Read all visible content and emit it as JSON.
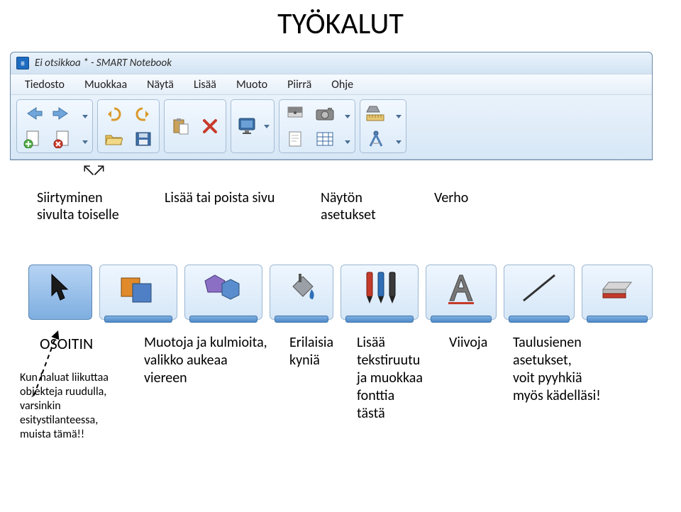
{
  "slide_title": "TYÖKALUT",
  "window": {
    "title": "Ei otsikkoa * - SMART Notebook",
    "app_icon_glyph": "≡"
  },
  "menubar": [
    "Tiedosto",
    "Muokkaa",
    "Näytä",
    "Lisää",
    "Muoto",
    "Piirrä",
    "Ohje"
  ],
  "toolbar1_names": {
    "back": "arrow-left-icon",
    "forward": "arrow-right-icon",
    "add_page": "add-page-icon",
    "undo": "undo-icon",
    "redo": "redo-icon",
    "delete_page": "delete-page-icon",
    "open": "open-folder-icon",
    "save": "save-icon",
    "paste": "paste-icon",
    "delete": "delete-x-icon",
    "display": "display-settings-icon",
    "screenshade": "screen-shade-icon",
    "camera": "camera-icon",
    "table": "table-icon",
    "ruler": "ruler-shapes-icon",
    "compass": "compass-icon"
  },
  "annotations1": {
    "move": "Siirtyminen\nsivulta toiselle",
    "addremove": "Lisää tai poista sivu",
    "display": "Näytön\nasetukset",
    "curtain": "Verho"
  },
  "annotations2": {
    "pointer_head": "OSOITIN",
    "pointer_note": "Kun haluat liikuttaa\nobjekteja ruudulla,\nvarsinkin\nesitystilanteessa,\nmuista tämä!!",
    "shapes": "Muotoja ja kulmioita,\nvalikko aukeaa\nviereen",
    "pens": "Erilaisia\nkyniä",
    "text": "Lisää\ntekstiruutu\nja muokkaa\nfonttia\ntästä",
    "lines": "Viivoja",
    "eraser": "Taulusienen\nasetukset,\nvoit pyyhkiä\nmyös kädelläsi!"
  }
}
